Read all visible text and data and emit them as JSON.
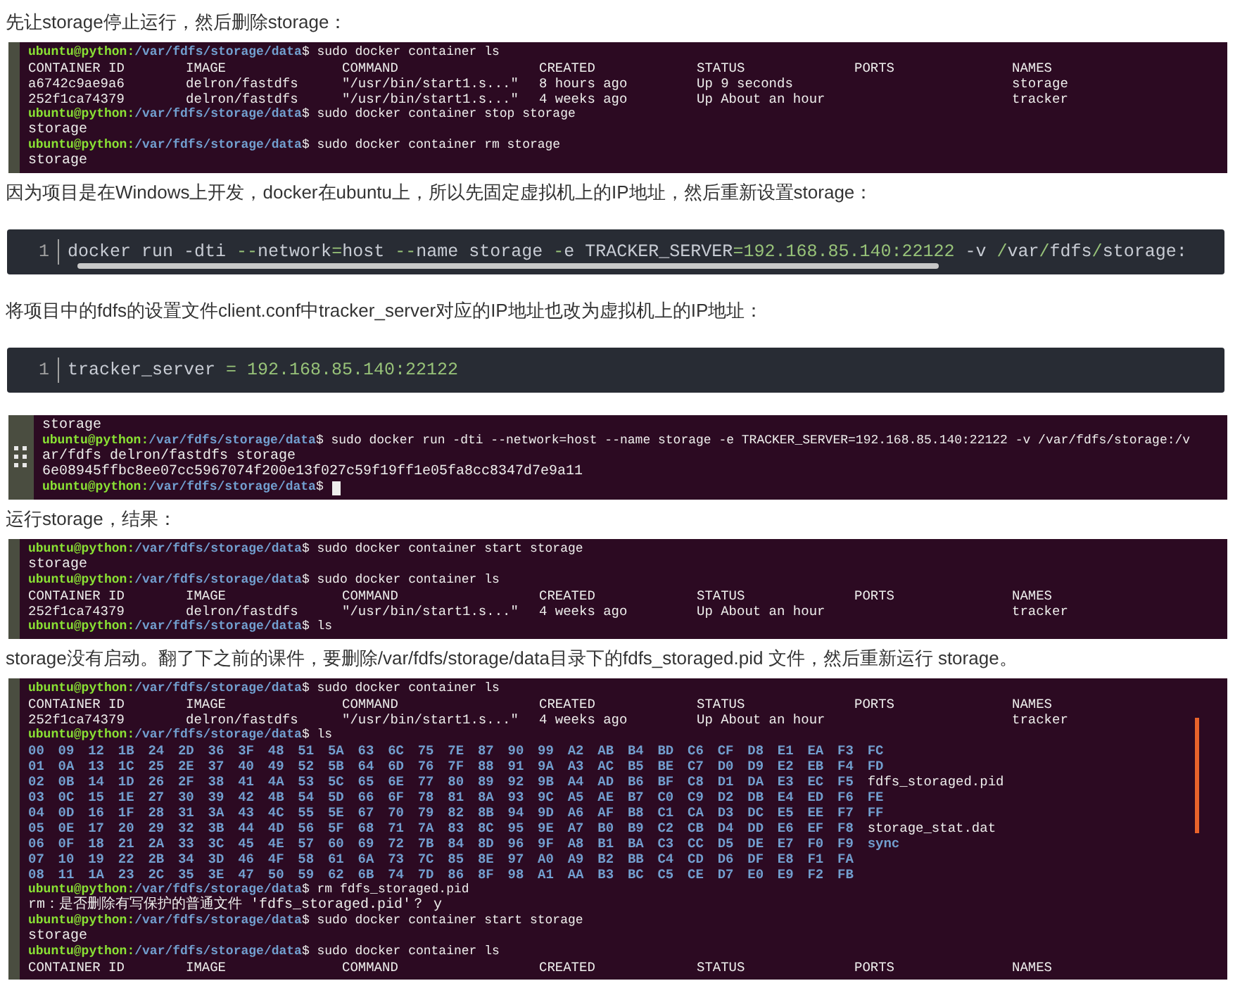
{
  "blocks": [
    {
      "kind": "paragraph",
      "text": "先让storage停止运行，然后删除storage："
    },
    {
      "kind": "terminal",
      "lines": [
        {
          "kind": "prompt",
          "user": "ubuntu@python:",
          "path": "/var/fdfs/storage/data",
          "command": "$ sudo docker container ls"
        },
        {
          "kind": "table",
          "cells": [
            "CONTAINER ID",
            "IMAGE",
            "COMMAND",
            "CREATED",
            "STATUS",
            "PORTS",
            "NAMES"
          ]
        },
        {
          "kind": "table",
          "cells": [
            "a6742c9ae9a6",
            "delron/fastdfs",
            "\"/usr/bin/start1.s...\"",
            "8 hours ago",
            "Up 9 seconds",
            "",
            "storage"
          ]
        },
        {
          "kind": "table",
          "cells": [
            "252f1ca74379",
            "delron/fastdfs",
            "\"/usr/bin/start1.s...\"",
            "4 weeks ago",
            "Up About an hour",
            "",
            "tracker"
          ]
        },
        {
          "kind": "prompt",
          "user": "ubuntu@python:",
          "path": "/var/fdfs/storage/data",
          "command": "$ sudo docker container stop storage"
        },
        {
          "kind": "output",
          "text": "storage"
        },
        {
          "kind": "prompt",
          "user": "ubuntu@python:",
          "path": "/var/fdfs/storage/data",
          "command": "$ sudo docker container rm storage"
        },
        {
          "kind": "output",
          "text": "storage"
        }
      ]
    },
    {
      "kind": "paragraph",
      "text": "因为项目是在Windows上开发，docker在ubuntu上，所以先固定虚拟机上的IP地址，然后重新设置storage："
    },
    {
      "kind": "code",
      "line_number": "1",
      "scrollbar": true,
      "tokens": [
        {
          "text": "docker run -dti ",
          "kind": "plain"
        },
        {
          "text": "--",
          "kind": "accent"
        },
        {
          "text": "network",
          "kind": "plain"
        },
        {
          "text": "=",
          "kind": "accent"
        },
        {
          "text": "host ",
          "kind": "plain"
        },
        {
          "text": "--",
          "kind": "accent"
        },
        {
          "text": "name storage ",
          "kind": "plain"
        },
        {
          "text": "-",
          "kind": "accent"
        },
        {
          "text": "e TRACKER_SERVER",
          "kind": "plain"
        },
        {
          "text": "=192.168.85.140:22122",
          "kind": "accent"
        },
        {
          "text": " -v ",
          "kind": "plain"
        },
        {
          "text": "/",
          "kind": "accent"
        },
        {
          "text": "var",
          "kind": "plain"
        },
        {
          "text": "/",
          "kind": "accent"
        },
        {
          "text": "fdfs",
          "kind": "plain"
        },
        {
          "text": "/",
          "kind": "accent"
        },
        {
          "text": "storage:",
          "kind": "plain"
        }
      ]
    },
    {
      "kind": "paragraph",
      "text": "将项目中的fdfs的设置文件client.conf中tracker_server对应的IP地址也改为虚拟机上的IP地址："
    },
    {
      "kind": "code",
      "line_number": "1",
      "scrollbar": false,
      "tokens": [
        {
          "text": "tracker_server ",
          "kind": "plain"
        },
        {
          "text": "= 192.168.85.140:22122",
          "kind": "accent"
        }
      ]
    },
    {
      "kind": "terminal",
      "handle": true,
      "lines": [
        {
          "kind": "output",
          "text": "storage"
        },
        {
          "kind": "prompt",
          "user": "ubuntu@python:",
          "path": "/var/fdfs/storage/data",
          "command": "$ sudo docker run -dti --network=host --name storage -e TRACKER_SERVER=192.168.85.140:22122 -v /var/fdfs/storage:/v"
        },
        {
          "kind": "output",
          "text": "ar/fdfs delron/fastdfs storage"
        },
        {
          "kind": "output",
          "text": "6e08945ffbc8ee07cc5967074f200e13f027c59f19ff1e05fa8cc8347d7e9a11"
        },
        {
          "kind": "prompt",
          "user": "ubuntu@python:",
          "path": "/var/fdfs/storage/data",
          "command": "$",
          "cursor": true
        }
      ]
    },
    {
      "kind": "paragraph",
      "text": "运行storage，结果："
    },
    {
      "kind": "terminal",
      "lines": [
        {
          "kind": "prompt",
          "user": "ubuntu@python:",
          "path": "/var/fdfs/storage/data",
          "command": "$ sudo docker container start storage"
        },
        {
          "kind": "output",
          "text": "storage"
        },
        {
          "kind": "prompt",
          "user": "ubuntu@python:",
          "path": "/var/fdfs/storage/data",
          "command": "$ sudo docker container ls"
        },
        {
          "kind": "table",
          "cells": [
            "CONTAINER ID",
            "IMAGE",
            "COMMAND",
            "CREATED",
            "STATUS",
            "PORTS",
            "NAMES"
          ]
        },
        {
          "kind": "table",
          "cells": [
            "252f1ca74379",
            "delron/fastdfs",
            "\"/usr/bin/start1.s...\"",
            "4 weeks ago",
            "Up About an hour",
            "",
            "tracker"
          ]
        },
        {
          "kind": "prompt",
          "user": "ubuntu@python:",
          "path": "/var/fdfs/storage/data",
          "command": "$ ls"
        }
      ]
    },
    {
      "kind": "paragraph",
      "text": "storage没有启动。翻了下之前的课件，要删除/var/fdfs/storage/data目录下的fdfs_storaged.pid 文件，然后重新运行 storage。"
    },
    {
      "kind": "terminal",
      "scrollbar": true,
      "lines": [
        {
          "kind": "prompt",
          "user": "ubuntu@python:",
          "path": "/var/fdfs/storage/data",
          "command": "$ sudo docker container ls"
        },
        {
          "kind": "table",
          "cells": [
            "CONTAINER ID",
            "IMAGE",
            "COMMAND",
            "CREATED",
            "STATUS",
            "PORTS",
            "NAMES"
          ]
        },
        {
          "kind": "table",
          "cells": [
            "252f1ca74379",
            "delron/fastdfs",
            "\"/usr/bin/start1.s...\"",
            "4 weeks ago",
            "Up About an hour",
            "",
            "tracker"
          ]
        },
        {
          "kind": "prompt",
          "user": "ubuntu@python:",
          "path": "/var/fdfs/storage/data",
          "command": "$ ls"
        },
        {
          "kind": "ls",
          "dirs": [
            "00",
            "09",
            "12",
            "1B",
            "24",
            "2D",
            "36",
            "3F",
            "48",
            "51",
            "5A",
            "63",
            "6C",
            "75",
            "7E",
            "87",
            "90",
            "99",
            "A2",
            "AB",
            "B4",
            "BD",
            "C6",
            "CF",
            "D8",
            "E1",
            "EA",
            "F3",
            "FC"
          ]
        },
        {
          "kind": "ls",
          "dirs": [
            "01",
            "0A",
            "13",
            "1C",
            "25",
            "2E",
            "37",
            "40",
            "49",
            "52",
            "5B",
            "64",
            "6D",
            "76",
            "7F",
            "88",
            "91",
            "9A",
            "A3",
            "AC",
            "B5",
            "BE",
            "C7",
            "D0",
            "D9",
            "E2",
            "EB",
            "F4",
            "FD"
          ]
        },
        {
          "kind": "ls",
          "dirs": [
            "02",
            "0B",
            "14",
            "1D",
            "26",
            "2F",
            "38",
            "41",
            "4A",
            "53",
            "5C",
            "65",
            "6E",
            "77",
            "80",
            "89",
            "92",
            "9B",
            "A4",
            "AD",
            "B6",
            "BF",
            "C8",
            "D1",
            "DA",
            "E3",
            "EC",
            "F5"
          ],
          "file": "fdfs_storaged.pid"
        },
        {
          "kind": "ls",
          "dirs": [
            "03",
            "0C",
            "15",
            "1E",
            "27",
            "30",
            "39",
            "42",
            "4B",
            "54",
            "5D",
            "66",
            "6F",
            "78",
            "81",
            "8A",
            "93",
            "9C",
            "A5",
            "AE",
            "B7",
            "C0",
            "C9",
            "D2",
            "DB",
            "E4",
            "ED",
            "F6",
            "FE"
          ]
        },
        {
          "kind": "ls",
          "dirs": [
            "04",
            "0D",
            "16",
            "1F",
            "28",
            "31",
            "3A",
            "43",
            "4C",
            "55",
            "5E",
            "67",
            "70",
            "79",
            "82",
            "8B",
            "94",
            "9D",
            "A6",
            "AF",
            "B8",
            "C1",
            "CA",
            "D3",
            "DC",
            "E5",
            "EE",
            "F7",
            "FF"
          ]
        },
        {
          "kind": "ls",
          "dirs": [
            "05",
            "0E",
            "17",
            "20",
            "29",
            "32",
            "3B",
            "44",
            "4D",
            "56",
            "5F",
            "68",
            "71",
            "7A",
            "83",
            "8C",
            "95",
            "9E",
            "A7",
            "B0",
            "B9",
            "C2",
            "CB",
            "D4",
            "DD",
            "E6",
            "EF",
            "F8"
          ],
          "file": "storage_stat.dat"
        },
        {
          "kind": "ls",
          "dirs": [
            "06",
            "0F",
            "18",
            "21",
            "2A",
            "33",
            "3C",
            "45",
            "4E",
            "57",
            "60",
            "69",
            "72",
            "7B",
            "84",
            "8D",
            "96",
            "9F",
            "A8",
            "B1",
            "BA",
            "C3",
            "CC",
            "D5",
            "DE",
            "E7",
            "F0",
            "F9",
            "sync"
          ]
        },
        {
          "kind": "ls",
          "dirs": [
            "07",
            "10",
            "19",
            "22",
            "2B",
            "34",
            "3D",
            "46",
            "4F",
            "58",
            "61",
            "6A",
            "73",
            "7C",
            "85",
            "8E",
            "97",
            "A0",
            "A9",
            "B2",
            "BB",
            "C4",
            "CD",
            "D6",
            "DF",
            "E8",
            "F1",
            "FA"
          ]
        },
        {
          "kind": "ls",
          "dirs": [
            "08",
            "11",
            "1A",
            "23",
            "2C",
            "35",
            "3E",
            "47",
            "50",
            "59",
            "62",
            "6B",
            "74",
            "7D",
            "86",
            "8F",
            "98",
            "A1",
            "AA",
            "B3",
            "BC",
            "C5",
            "CE",
            "D7",
            "E0",
            "E9",
            "F2",
            "FB"
          ]
        },
        {
          "kind": "prompt",
          "user": "ubuntu@python:",
          "path": "/var/fdfs/storage/data",
          "command": "$ rm fdfs_storaged.pid"
        },
        {
          "kind": "output",
          "text": "rm：是否删除有写保护的普通文件 'fdfs_storaged.pid'？ y"
        },
        {
          "kind": "prompt",
          "user": "ubuntu@python:",
          "path": "/var/fdfs/storage/data",
          "command": "$ sudo docker container start storage"
        },
        {
          "kind": "output",
          "text": "storage"
        },
        {
          "kind": "prompt",
          "user": "ubuntu@python:",
          "path": "/var/fdfs/storage/data",
          "command": "$ sudo docker container ls"
        },
        {
          "kind": "table",
          "cells": [
            "CONTAINER ID",
            "IMAGE",
            "COMMAND",
            "CREATED",
            "STATUS",
            "PORTS",
            "NAMES"
          ]
        }
      ]
    }
  ]
}
